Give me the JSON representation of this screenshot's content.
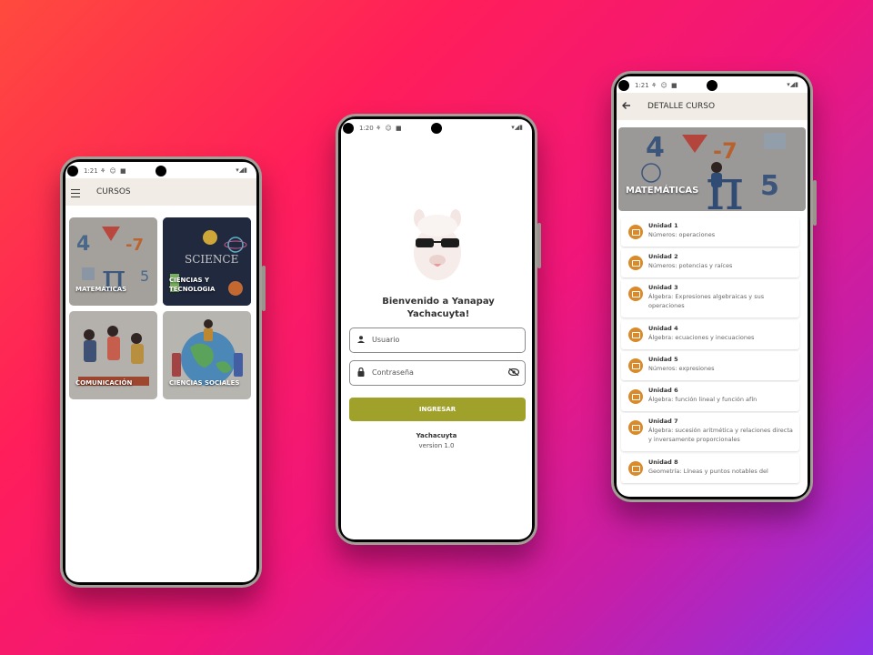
{
  "phone_left": {
    "status": {
      "time": "1:21",
      "icons": "⚘ ☺ ■",
      "right_icons": "▾◢▮"
    },
    "appbar_title": "CURSOS",
    "courses": [
      {
        "label": "MATEMÁTICAS",
        "color": "#d9d5d0"
      },
      {
        "label": "CIENCIAS Y TECNOLOGIA",
        "color": "#273146"
      },
      {
        "label": "COMUNICACIÓN",
        "color": "#e0dcd6"
      },
      {
        "label": "CIENCIAS SOCIALES",
        "color": "#e2dfd9"
      }
    ]
  },
  "phone_center": {
    "status": {
      "time": "1:20",
      "icons": "⚘ ☺ ■",
      "right_icons": "▾◢▮"
    },
    "welcome": "Bienvenido a Yanapay Yachacuyta!",
    "username_placeholder": "Usuario",
    "password_placeholder": "Contraseña",
    "login_button": "INGRESAR",
    "app_name": "Yachacuyta",
    "version": "version 1.0",
    "accent": "#a0a12a"
  },
  "phone_right": {
    "status": {
      "time": "1:21",
      "icons": "⚘ ☺ ■",
      "right_icons": "▾◢▮"
    },
    "appbar_title": "DETALLE CURSO",
    "banner_title": "MATEMÁTICAS",
    "units": [
      {
        "title": "Unidad 1",
        "subtitle": "Números: operaciones"
      },
      {
        "title": "Unidad 2",
        "subtitle": "Números: potencias y raíces"
      },
      {
        "title": "Unidad 3",
        "subtitle": "Álgebra: Expresiones algebraicas y sus operaciones"
      },
      {
        "title": "Unidad 4",
        "subtitle": "Álgebra: ecuaciones y inecuaciones"
      },
      {
        "title": "Unidad 5",
        "subtitle": "Números: expresiones"
      },
      {
        "title": "Unidad 6",
        "subtitle": "Álgebra: función lineal y función afín"
      },
      {
        "title": "Unidad 7",
        "subtitle": "Álgebra: sucesión aritmética y relaciones directa y inversamente proporcionales"
      },
      {
        "title": "Unidad 8",
        "subtitle": "Geometría: Líneas y puntos notables del"
      }
    ],
    "icon_color": "#d98a2a"
  }
}
